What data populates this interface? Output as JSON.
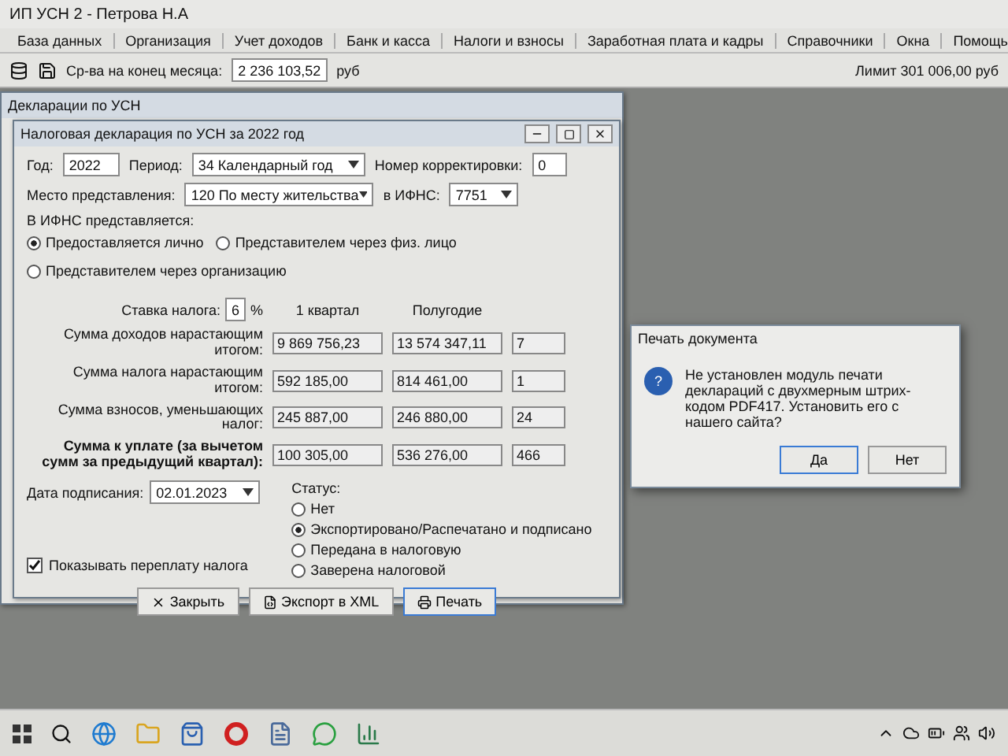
{
  "app": {
    "title": "ИП УСН 2 - Петрова Н.А",
    "menu": [
      "База данных",
      "Организация",
      "Учет доходов",
      "Банк и касса",
      "Налоги и взносы",
      "Заработная плата и кадры",
      "Справочники",
      "Окна",
      "Помощь"
    ],
    "toolbar": {
      "balance_label": "Ср-ва на конец месяца:",
      "balance_value": "2 236 103,52",
      "unit": "руб",
      "limit": "Лимит 301 006,00 руб"
    }
  },
  "back_window": {
    "title": "Декларации по УСН"
  },
  "declaration": {
    "title": "Налоговая декларация по УСН за 2022 год",
    "year_label": "Год:",
    "year": "2022",
    "period_label": "Период:",
    "period": "34 Календарный год",
    "correction_label": "Номер корректировки:",
    "correction": "0",
    "place_label": "Место представления:",
    "place": "120 По месту жительства",
    "ifns_label": "в ИФНС:",
    "ifns": "7751",
    "submit_label": "В ИФНС представляется:",
    "submit_options": [
      {
        "label": "Предоставляется лично",
        "selected": true
      },
      {
        "label": "Представителем через физ. лицо",
        "selected": false
      },
      {
        "label": "Представителем через организацию",
        "selected": false
      }
    ],
    "rate_label": "Ставка налога:",
    "rate": "6",
    "rate_unit": "%",
    "columns": [
      "1 квартал",
      "Полугодие"
    ],
    "rows": [
      {
        "label": "Сумма доходов нарастающим итогом:",
        "emphasis": false,
        "values": [
          "9 869 756,23",
          "13 574 347,11",
          "7"
        ]
      },
      {
        "label": "Сумма налога нарастающим итогом:",
        "emphasis": false,
        "values": [
          "592 185,00",
          "814 461,00",
          "1"
        ]
      },
      {
        "label": "Сумма взносов, уменьшающих налог:",
        "emphasis": false,
        "values": [
          "245 887,00",
          "246 880,00",
          "24"
        ]
      },
      {
        "label": "Сумма к уплате (за вычетом сумм за предыдущий квартал):",
        "emphasis": true,
        "values": [
          "100 305,00",
          "536 276,00",
          "466"
        ]
      }
    ],
    "sign_date_label": "Дата подписания:",
    "sign_date": "02.01.2023",
    "status_label": "Статус:",
    "status_options": [
      {
        "label": "Нет",
        "selected": false
      },
      {
        "label": "Экспортировано/Распечатано и подписано",
        "selected": true
      },
      {
        "label": "Передана в налоговую",
        "selected": false
      },
      {
        "label": "Заверена налоговой",
        "selected": false
      }
    ],
    "show_overpay": {
      "label": "Показывать переплату налога",
      "checked": true
    },
    "buttons": [
      {
        "kind": "close",
        "label": "Закрыть",
        "default": false
      },
      {
        "kind": "export",
        "label": "Экспорт в XML",
        "default": false
      },
      {
        "kind": "print",
        "label": "Печать",
        "default": true
      }
    ]
  },
  "dialog": {
    "title": "Печать документа",
    "icon": "?",
    "message": "Не установлен модуль печати деклараций с двухмерным штрих-кодом PDF417. Установить его с нашего сайта?",
    "buttons": [
      {
        "label": "Да",
        "default": true
      },
      {
        "label": "Нет",
        "default": false
      }
    ]
  }
}
